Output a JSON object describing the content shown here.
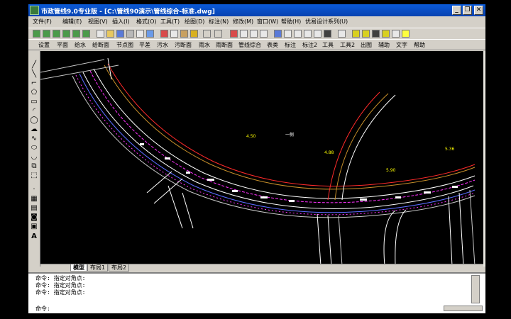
{
  "window": {
    "title": "市政管线9.0专业版 - [C:\\管线90演示\\管线综合-标准.dwg]",
    "controls": [
      "_",
      "❐",
      "✕"
    ]
  },
  "menubar": {
    "items": [
      "文件(F)",
      "编辑(E)",
      "视图(V)",
      "插入(I)",
      "格式(O)",
      "工具(T)",
      "绘图(D)",
      "标注(N)",
      "修改(M)",
      "窗口(W)",
      "帮助(H)",
      "优易设计系列(U)"
    ]
  },
  "toolbar2": {
    "items": [
      "设置",
      "平面",
      "给水",
      "给断面",
      "节点图",
      "平差",
      "污水",
      "污断面",
      "雨水",
      "雨断面",
      "管线综合",
      "表类",
      "标注",
      "标注2",
      "工具",
      "工具2",
      "出图",
      "辅助",
      "文字",
      "帮助"
    ]
  },
  "drawing": {
    "labels": [
      "4.50",
      "一侧",
      "4.88",
      "5.90",
      "5.36"
    ],
    "colors": {
      "background": "#000000",
      "road_edge": "#ffffff",
      "pipe_magenta": "#ff33ff",
      "pipe_blue": "#5a6cff",
      "pipe_brown": "#c8902a",
      "pipe_red": "#ff2a2a",
      "text_yellow": "#ffff00"
    }
  },
  "tabs": [
    "模型",
    "布局1",
    "布局2"
  ],
  "command": {
    "lines": [
      "命令: 指定对角点:",
      "命令: 指定对角点:",
      "命令: 指定对角点:"
    ],
    "prompt": "命令:"
  }
}
